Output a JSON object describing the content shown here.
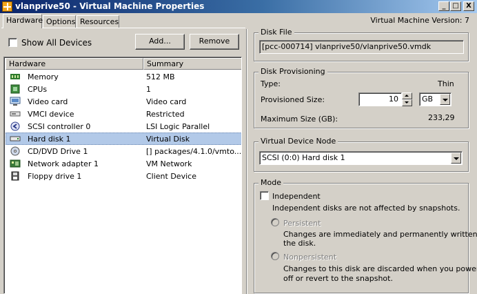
{
  "window": {
    "title": "vlanprive50 - Virtual Machine Properties",
    "min_glyph": "_",
    "max_glyph": "□",
    "close_glyph": "X"
  },
  "tabs": [
    {
      "label": "Hardware",
      "active": true
    },
    {
      "label": "Options",
      "active": false
    },
    {
      "label": "Resources",
      "active": false
    }
  ],
  "vm_version": "Virtual Machine Version: 7",
  "left": {
    "show_all_devices_label": "Show All Devices",
    "show_all_devices_checked": false,
    "add_label": "Add...",
    "remove_label": "Remove",
    "columns": [
      "Hardware",
      "Summary"
    ],
    "devices": [
      {
        "icon": "memory-icon",
        "name": "Memory",
        "summary": "512 MB",
        "selected": false
      },
      {
        "icon": "cpu-icon",
        "name": "CPUs",
        "summary": "1",
        "selected": false
      },
      {
        "icon": "video-card-icon",
        "name": "Video card",
        "summary": "Video card",
        "selected": false
      },
      {
        "icon": "vmci-icon",
        "name": "VMCI device",
        "summary": "Restricted",
        "selected": false
      },
      {
        "icon": "scsi-icon",
        "name": "SCSI controller 0",
        "summary": "LSI Logic Parallel",
        "selected": false
      },
      {
        "icon": "hard-disk-icon",
        "name": "Hard disk 1",
        "summary": "Virtual Disk",
        "selected": true
      },
      {
        "icon": "cd-dvd-icon",
        "name": "CD/DVD Drive 1",
        "summary": "[] packages/4.1.0/vmto...",
        "selected": false
      },
      {
        "icon": "network-adapter-icon",
        "name": "Network adapter 1",
        "summary": "VM Network",
        "selected": false
      },
      {
        "icon": "floppy-icon",
        "name": "Floppy drive 1",
        "summary": "Client Device",
        "selected": false
      }
    ]
  },
  "disk_file": {
    "title": "Disk File",
    "value": "[pcc-000714] vlanprive50/vlanprive50.vmdk"
  },
  "provisioning": {
    "title": "Disk Provisioning",
    "type_label": "Type:",
    "type_value": "Thin",
    "size_label": "Provisioned Size:",
    "size_value": "10",
    "unit": "GB",
    "max_label": "Maximum Size (GB):",
    "max_value": "233,29"
  },
  "device_node": {
    "title": "Virtual Device Node",
    "value": "SCSI (0:0) Hard disk 1"
  },
  "mode": {
    "title": "Mode",
    "independent_label": "Independent",
    "independent_checked": false,
    "independent_desc": "Independent disks are not affected by snapshots.",
    "persistent_label": "Persistent",
    "persistent_desc_1": "Changes are immediately and permanently written to",
    "persistent_desc_2": "the disk.",
    "nonpersistent_label": "Nonpersistent",
    "nonpersistent_desc_1": "Changes to this disk are discarded when you power",
    "nonpersistent_desc_2": "off or revert to the snapshot."
  }
}
